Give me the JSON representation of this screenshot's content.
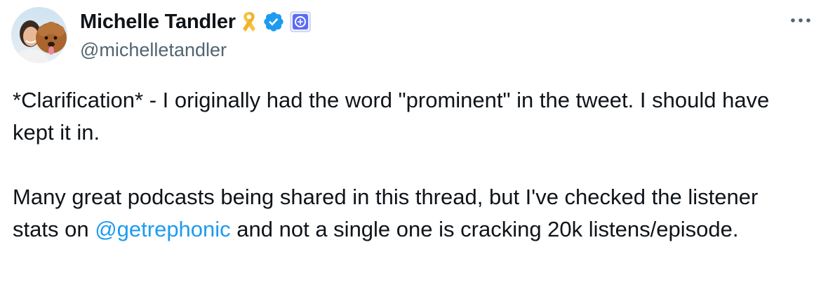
{
  "author": {
    "display_name": "Michelle Tandler",
    "handle": "@michelletandler"
  },
  "badges": [
    {
      "icon": "yellow-ribbon-icon",
      "color": "#f6c342"
    },
    {
      "icon": "verified-badge-icon",
      "color": "#1d9bf0"
    },
    {
      "icon": "affiliate-badge-icon",
      "color": "#5b6cf0"
    }
  ],
  "more_menu_icon": "ellipsis-icon",
  "tweet": {
    "paragraph_1": "*Clarification* - I originally had the word \"prominent\" in the tweet. I should have kept it in.",
    "paragraph_2_before": "Many great podcasts being shared in this thread, but I've checked the listener stats on ",
    "mention": "@getrephonic",
    "paragraph_2_after": " and not a single one is cracking 20k listens/episode."
  },
  "colors": {
    "text": "#0f1419",
    "secondary": "#536471",
    "link": "#1d9bf0"
  }
}
